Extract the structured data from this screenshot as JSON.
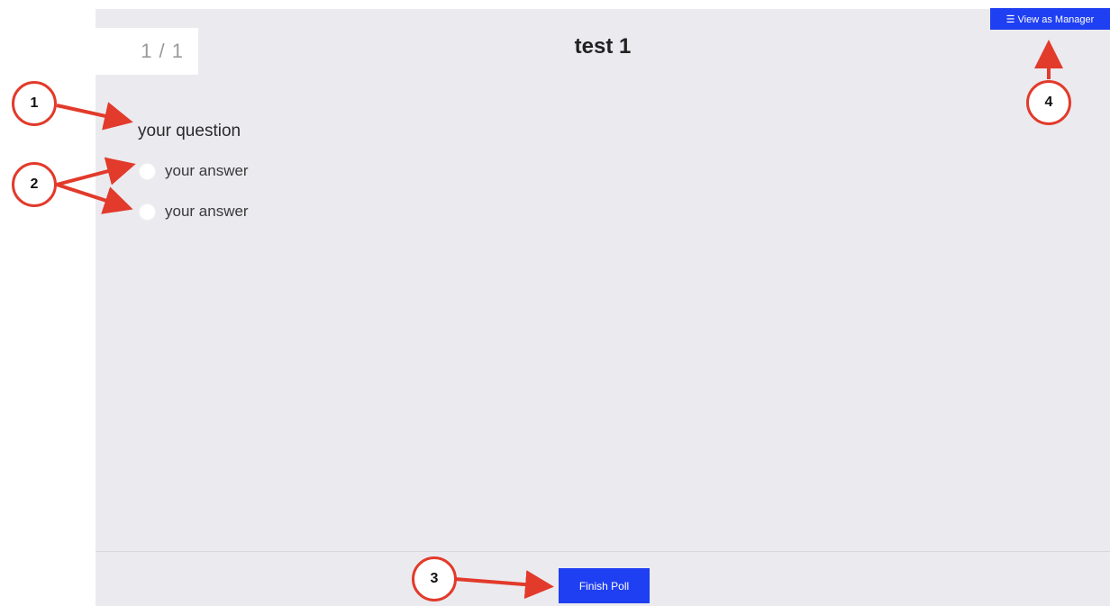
{
  "poll": {
    "counter": "1 / 1",
    "title": "test 1",
    "question": "your question",
    "options": [
      {
        "label": "your answer"
      },
      {
        "label": "your answer"
      }
    ],
    "finish_label": "Finish Poll"
  },
  "header": {
    "manager_label": "View as Manager",
    "manager_icon": "list-icon"
  },
  "annotations": {
    "callouts": [
      "1",
      "2",
      "3",
      "4"
    ]
  },
  "colors": {
    "accent": "#1f3ff2",
    "annotation": "#e23a2b",
    "panel_bg": "#ebeaef"
  }
}
